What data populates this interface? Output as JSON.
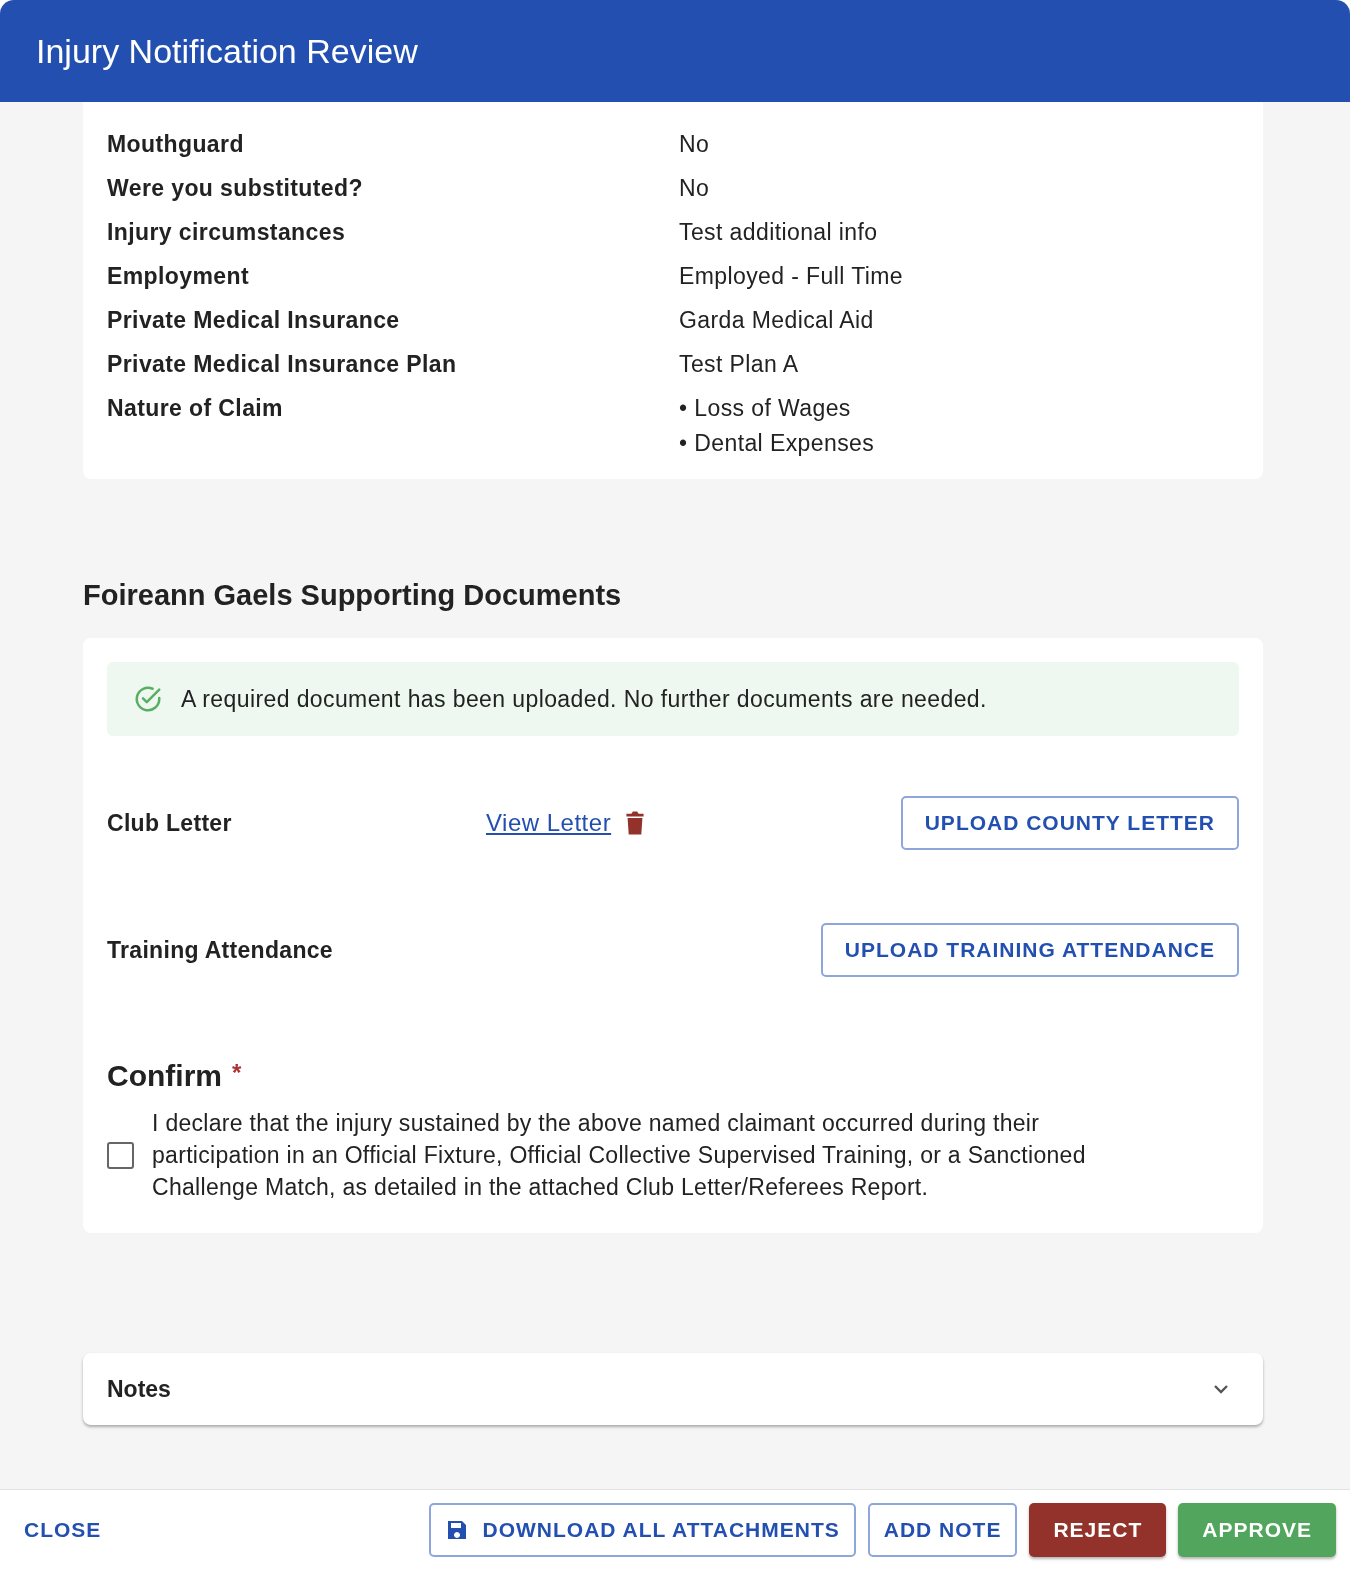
{
  "window": {
    "title": "Injury Notification Review"
  },
  "details": [
    {
      "label": "Mouthguard",
      "values": [
        "No"
      ]
    },
    {
      "label": "Were you substituted?",
      "values": [
        "No"
      ]
    },
    {
      "label": "Injury circumstances",
      "values": [
        "Test additional info"
      ]
    },
    {
      "label": "Employment",
      "values": [
        "Employed - Full Time"
      ]
    },
    {
      "label": "Private Medical Insurance",
      "values": [
        "Garda Medical Aid"
      ]
    },
    {
      "label": "Private Medical Insurance Plan",
      "values": [
        "Test Plan A"
      ]
    },
    {
      "label": "Nature of Claim",
      "values": [
        "• Loss of Wages",
        "• Dental Expenses"
      ]
    }
  ],
  "documents": {
    "title": "Foireann Gaels Supporting Documents",
    "alert": "A required document has been uploaded. No further documents are needed.",
    "rows": [
      {
        "label": "Club Letter",
        "link": "View Letter",
        "deletable": true,
        "button": "UPLOAD COUNTY LETTER"
      },
      {
        "label": "Training Attendance",
        "button": "UPLOAD TRAINING ATTENDANCE"
      }
    ],
    "confirm": {
      "title": "Confirm",
      "required_mark": "*",
      "text": "I declare that the injury sustained by the above named claimant occurred during their participation in an Official Fixture, Official Collective Supervised Training, or a Sanctioned Challenge Match, as detailed in the attached Club Letter/Referees Report.",
      "checked": false
    }
  },
  "notes": {
    "title": "Notes",
    "expanded": false
  },
  "footer": [
    {
      "label": "CLOSE",
      "kind": "text"
    },
    {
      "label": "DOWNLOAD ALL ATTACHMENTS",
      "kind": "outlined",
      "icon": true
    },
    {
      "label": "ADD NOTE",
      "kind": "outlined"
    },
    {
      "label": "REJECT",
      "kind": "danger"
    },
    {
      "label": "APPROVE",
      "kind": "success"
    }
  ]
}
